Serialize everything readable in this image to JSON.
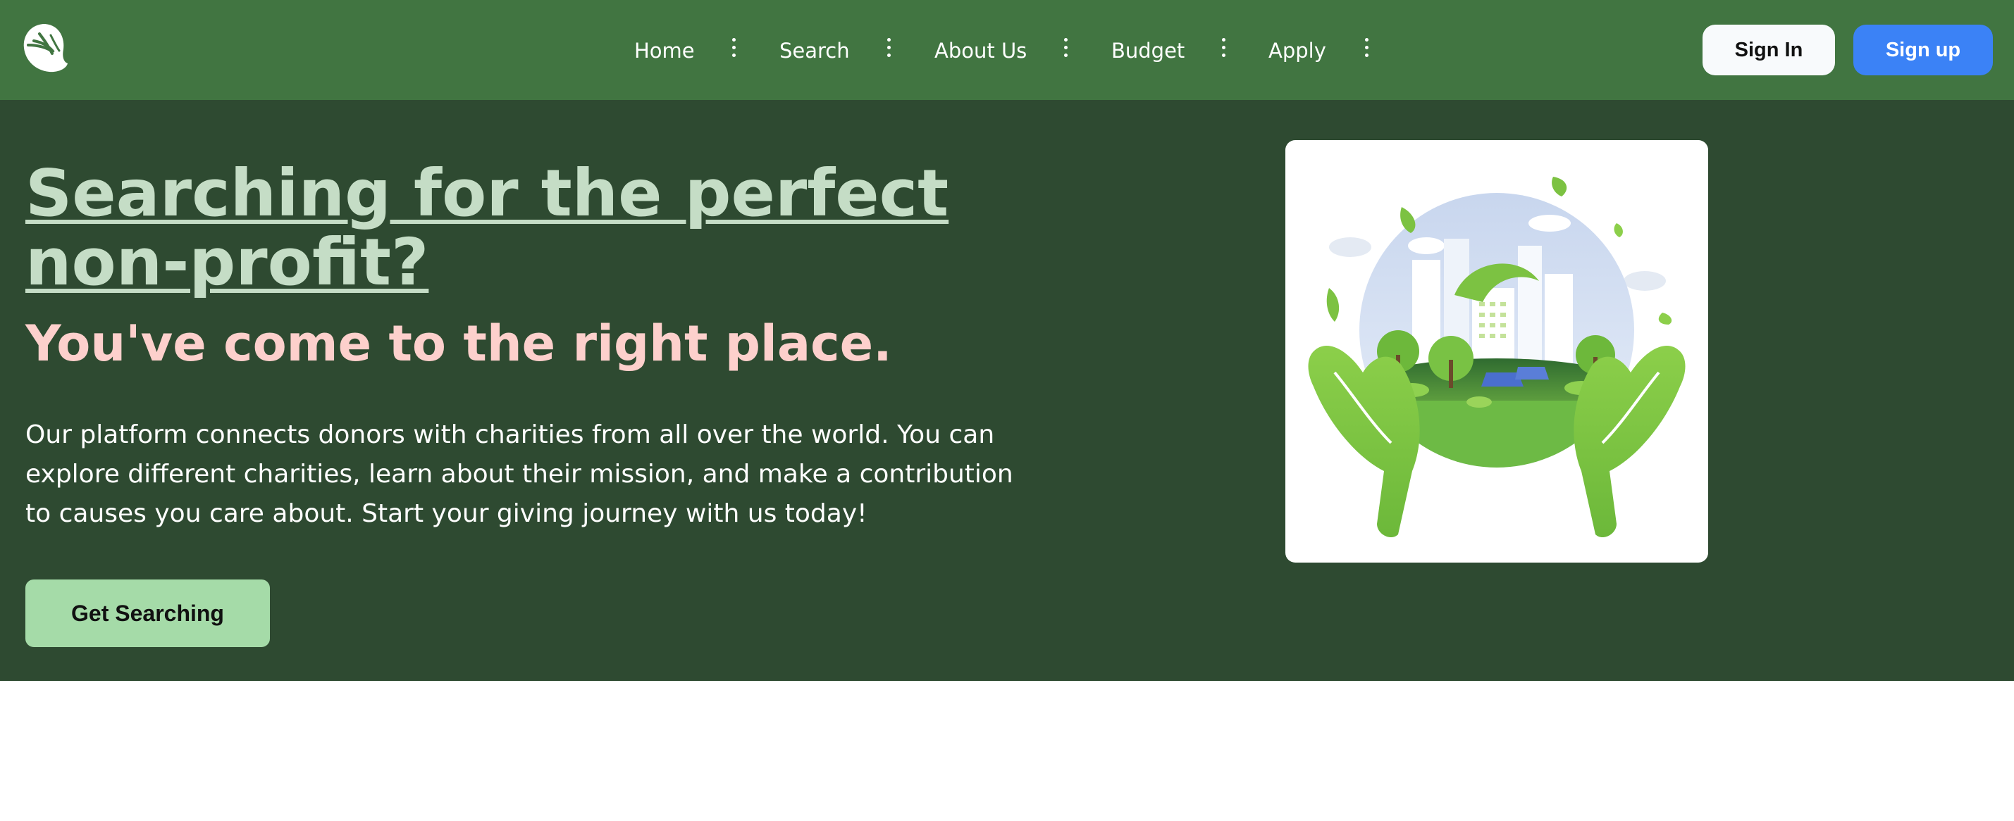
{
  "header": {
    "logo_icon": "leaf-logo-icon",
    "nav": [
      {
        "label": "Home"
      },
      {
        "label": "Search"
      },
      {
        "label": "About Us"
      },
      {
        "label": "Budget"
      },
      {
        "label": "Apply"
      }
    ],
    "signin_label": "Sign In",
    "signup_label": "Sign up"
  },
  "hero": {
    "title": "Searching for the perfect non-profit?",
    "subtitle": "You've come to the right place.",
    "description": "Our platform connects donors with charities from all over the world. You can explore different charities, learn about their mission, and make a contribution to causes you care about. Start your giving journey with us today!",
    "cta_label": "Get Searching",
    "illustration": "hands-holding-green-city-illustration"
  },
  "colors": {
    "header_bg": "#417541",
    "hero_bg": "#2e4a31",
    "title": "#c5ddc6",
    "subtitle": "#fdd0cc",
    "cta_bg": "#a5dba8",
    "signup_bg": "#3b82f6",
    "signin_bg": "#f8fafc"
  }
}
